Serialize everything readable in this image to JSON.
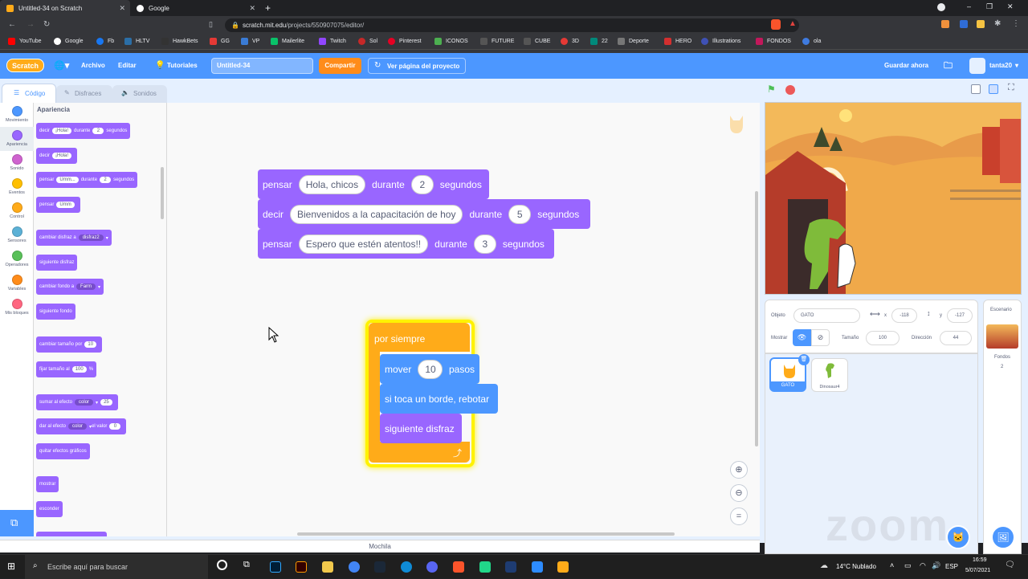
{
  "browser": {
    "tabs": [
      {
        "title": "Untitled-34 on Scratch",
        "active": true
      },
      {
        "title": "Google",
        "active": false
      }
    ],
    "url_host": "scratch.mit.edu",
    "url_path": "/projects/550907075/editor/",
    "bookmarks": [
      "YouTube",
      "Google",
      "Fb",
      "HLTV",
      "HawkBets",
      "GG",
      "VP",
      "Mailerlite",
      "Twitch",
      "Sol",
      "Pinterest",
      "ICONOS",
      "FUTURE",
      "CUBE",
      "3D",
      "22",
      "Deporte",
      "HERO",
      "Illustrations",
      "FONDOS",
      "ola"
    ]
  },
  "menubar": {
    "logo": "Scratch",
    "archivo": "Archivo",
    "editar": "Editar",
    "tutoriales": "Tutoriales",
    "project_title": "Untitled-34",
    "share": "Compartir",
    "project_page": "Ver página del proyecto",
    "save_now": "Guardar ahora",
    "username": "tanta20"
  },
  "tabs": {
    "code": "Código",
    "costumes": "Disfraces",
    "sounds": "Sonidos"
  },
  "categories": [
    {
      "label": "Movimiento",
      "color": "#4c97ff"
    },
    {
      "label": "Apariencia",
      "color": "#9966ff"
    },
    {
      "label": "Sonido",
      "color": "#cf63cf"
    },
    {
      "label": "Eventos",
      "color": "#ffbf00"
    },
    {
      "label": "Control",
      "color": "#ffab19"
    },
    {
      "label": "Sensores",
      "color": "#5cb1d6"
    },
    {
      "label": "Operadores",
      "color": "#59c059"
    },
    {
      "label": "Variables",
      "color": "#ff8c1a"
    },
    {
      "label": "Mis bloques",
      "color": "#ff6680"
    }
  ],
  "palette": {
    "heading": "Apariencia",
    "b1": {
      "a": "decir",
      "hola": "¡Hola!",
      "b": "durante",
      "n": "2",
      "c": "segundos"
    },
    "b2": {
      "a": "decir",
      "hola": "¡Hola!"
    },
    "b3": {
      "a": "pensar",
      "umm": "Umm...",
      "b": "durante",
      "n": "2",
      "c": "segundos"
    },
    "b4": {
      "a": "pensar",
      "umm": "Umm"
    },
    "b5": {
      "a": "cambiar disfraz a",
      "v": "disfraz2"
    },
    "b6": "siguiente disfraz",
    "b7": {
      "a": "cambiar fondo a",
      "v": "Farm"
    },
    "b8": "siguiente fondo",
    "b9": {
      "a": "cambiar tamaño por",
      "n": "10"
    },
    "b10": {
      "a": "fijar tamaño al",
      "n": "100",
      "c": "%"
    },
    "b11": {
      "a": "sumar al efecto",
      "v": "color",
      "n": "25"
    },
    "b12": {
      "a": "dar al efecto",
      "v": "color",
      "b": "el valor",
      "n": "0"
    },
    "b13": "quitar efectos gráficos",
    "b14": "mostrar",
    "b15": "esconder"
  },
  "script1": [
    {
      "verb": "pensar",
      "text": "Hola, chicos",
      "dur": "durante",
      "n": "2",
      "unit": "segundos"
    },
    {
      "verb": "decir",
      "text": "Bienvenidos a la capacitación de hoy",
      "dur": "durante",
      "n": "5",
      "unit": "segundos"
    },
    {
      "verb": "pensar",
      "text": "Espero que estén atentos!!",
      "dur": "durante",
      "n": "3",
      "unit": "segundos"
    }
  ],
  "script2": {
    "forever": "por siempre",
    "move": {
      "a": "mover",
      "n": "10",
      "b": "pasos"
    },
    "bounce": "si toca un borde, rebotar",
    "next": "siguiente disfraz"
  },
  "backpack": "Mochila",
  "sprite_info": {
    "object_label": "Objeto",
    "object_name": "GATO",
    "x_label": "x",
    "x_value": "-118",
    "y_label": "y",
    "y_value": "-127",
    "show_label": "Mostrar",
    "size_label": "Tamaño",
    "size_value": "100",
    "direction_label": "Dirección",
    "direction_value": "44"
  },
  "sprites": [
    {
      "name": "GATO",
      "selected": true
    },
    {
      "name": "Dinosaur4",
      "selected": false
    }
  ],
  "stage_panel": {
    "label": "Escenario",
    "backdrops_label": "Fondos",
    "backdrops_count": "2"
  },
  "zoom_watermark": "zoom",
  "taskbar": {
    "search_placeholder": "Escribe aquí para buscar",
    "weather": "14°C  Nublado",
    "lang": "ESP",
    "time": "16:59",
    "date": "5/07/2021"
  }
}
